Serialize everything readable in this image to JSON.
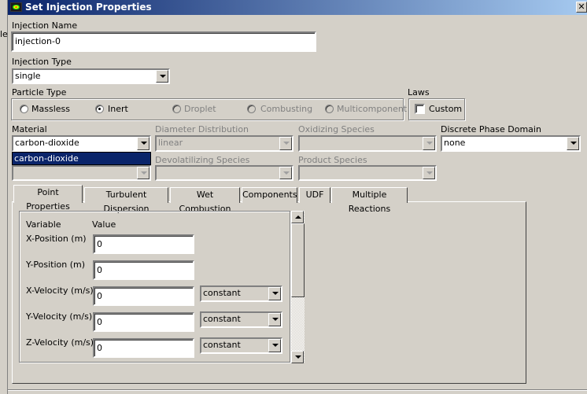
{
  "background_window": {
    "partial_text": "le"
  },
  "dialog": {
    "title": "Set Injection Properties",
    "close": "✕"
  },
  "injection_name": {
    "label": "Injection Name",
    "value": "injection-0"
  },
  "injection_type": {
    "label": "Injection Type",
    "value": "single"
  },
  "particle_type": {
    "label": "Particle Type",
    "options": [
      {
        "label": "Massless",
        "selected": false,
        "enabled": true
      },
      {
        "label": "Inert",
        "selected": true,
        "enabled": true
      },
      {
        "label": "Droplet",
        "selected": false,
        "enabled": false
      },
      {
        "label": "Combusting",
        "selected": false,
        "enabled": false
      },
      {
        "label": "Multicomponent",
        "selected": false,
        "enabled": false
      }
    ]
  },
  "laws": {
    "label": "Laws",
    "custom_label": "Custom",
    "custom_checked": false
  },
  "material": {
    "label": "Material",
    "value": "carbon-dioxide",
    "dropdown_items": [
      "carbon-dioxide"
    ]
  },
  "diameter_distribution": {
    "label": "Diameter Distribution",
    "value": "linear"
  },
  "oxidizing_species": {
    "label": "Oxidizing Species",
    "value": ""
  },
  "discrete_phase_domain": {
    "label": "Discrete Phase Domain",
    "value": "none"
  },
  "devolatilizing_species": {
    "label": "Devolatilizing Species",
    "value": ""
  },
  "product_species": {
    "label": "Product Species",
    "value": ""
  },
  "tabs": [
    "Point Properties",
    "Turbulent Dispersion",
    "Wet Combustion",
    "Components",
    "UDF",
    "Multiple Reactions"
  ],
  "active_tab": "Point Properties",
  "point_properties": {
    "headers": {
      "variable": "Variable",
      "value": "Value"
    },
    "rows": [
      {
        "label": "X-Position (m)",
        "value": "0"
      },
      {
        "label": "Y-Position (m)",
        "value": "0"
      },
      {
        "label": "X-Velocity (m/s)",
        "value": "0",
        "profile": "constant"
      },
      {
        "label": "Y-Velocity (m/s)",
        "value": "0",
        "profile": "constant"
      },
      {
        "label": "Z-Velocity (m/s)",
        "value": "0",
        "profile": "constant"
      }
    ]
  }
}
